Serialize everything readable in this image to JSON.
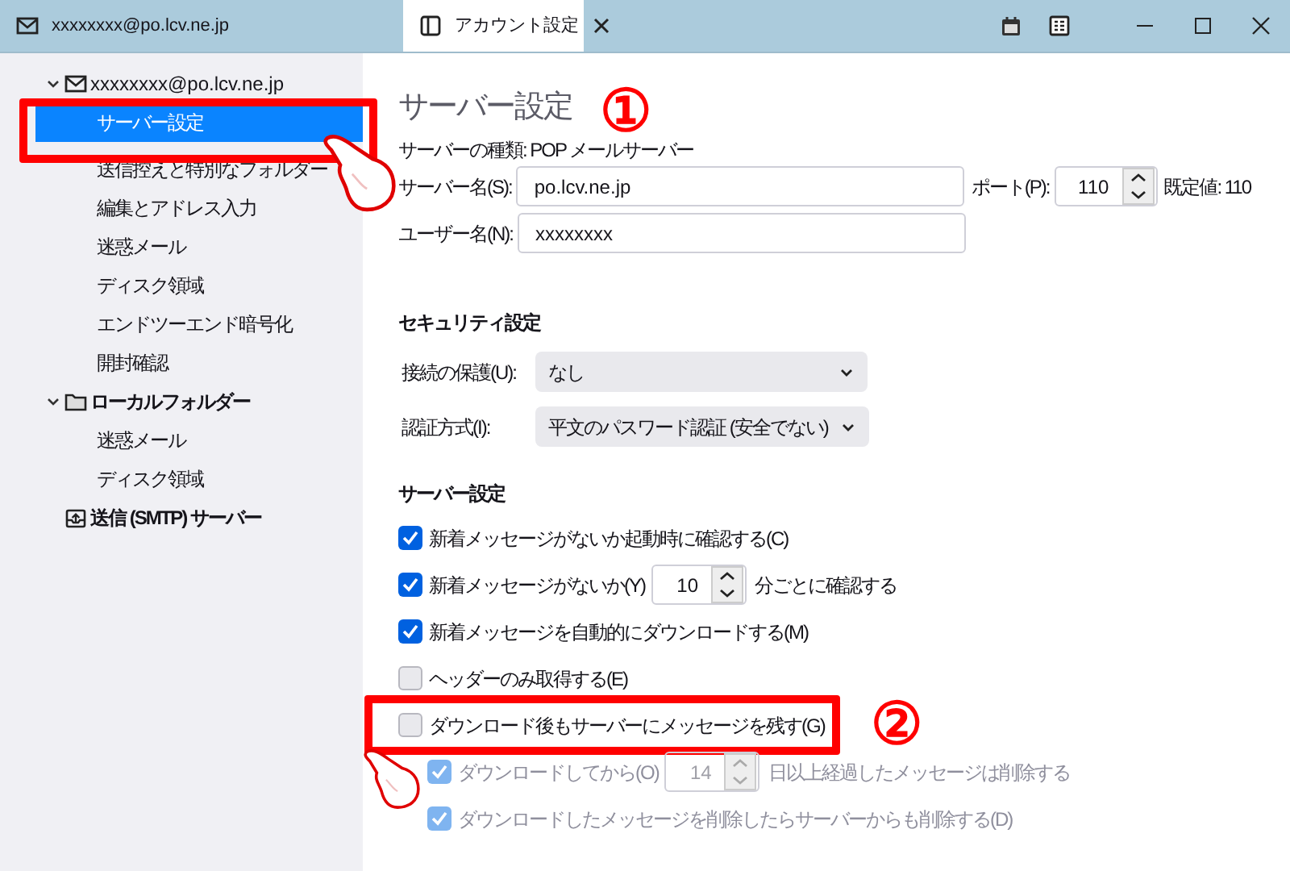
{
  "tabs": [
    {
      "label": "xxxxxxxx@po.lcv.ne.jp",
      "selected": false
    },
    {
      "label": "アカウント設定",
      "selected": true
    }
  ],
  "sidebar": {
    "items": [
      {
        "kind": "account",
        "label": "xxxxxxxx@po.lcv.ne.jp",
        "expanded": true,
        "selected": false,
        "children": [
          {
            "label": "サーバー設定",
            "selected": true
          },
          {
            "label": "送信控えと特別なフォルダー",
            "selected": false
          },
          {
            "label": "編集とアドレス入力",
            "selected": false
          },
          {
            "label": "迷惑メール",
            "selected": false
          },
          {
            "label": "ディスク領域",
            "selected": false
          },
          {
            "label": "エンドツーエンド暗号化",
            "selected": false
          },
          {
            "label": "開封確認",
            "selected": false
          }
        ]
      },
      {
        "kind": "folder",
        "label": "ローカルフォルダー",
        "expanded": true,
        "selected": false,
        "children": [
          {
            "label": "迷惑メール",
            "selected": false
          },
          {
            "label": "ディスク領域",
            "selected": false
          }
        ]
      },
      {
        "kind": "outbox",
        "label": "送信 (SMTP) サーバー",
        "selected": false
      }
    ]
  },
  "main": {
    "title": "サーバー設定",
    "server_type": "サーバーの種類: POP メールサーバー",
    "server_name": {
      "label": "サーバー名(S):",
      "value": "po.lcv.ne.jp"
    },
    "port": {
      "label": "ポート(P):",
      "value": "110",
      "default": "既定値: 110"
    },
    "user_name": {
      "label": "ユーザー名(N):",
      "value": "xxxxxxxx"
    },
    "security": {
      "heading": "セキュリティ設定",
      "fields": [
        {
          "label": "接続の保護(U):",
          "value": "なし"
        },
        {
          "label": "認証方式(I):",
          "value": "平文のパスワード認証 (安全でない)"
        }
      ]
    },
    "server_settings": {
      "heading": "サーバー設定",
      "options": [
        {
          "kind": "plain",
          "label": "新着メッセージがないか起動時に確認する(C)",
          "checked": true,
          "disabled": false
        },
        {
          "kind": "interval",
          "label": "新着メッセージがないか(Y)",
          "value": "10",
          "suffix": "分ごとに確認する",
          "checked": true,
          "disabled": false
        },
        {
          "kind": "plain",
          "label": "新着メッセージを自動的にダウンロードする(M)",
          "checked": true,
          "disabled": false
        },
        {
          "kind": "plain",
          "label": "ヘッダーのみ取得する(E)",
          "checked": false,
          "disabled": false
        },
        {
          "kind": "plain",
          "label": "ダウンロード後もサーバーにメッセージを残す(G)",
          "checked": false,
          "disabled": false,
          "children": [
            {
              "kind": "interval",
              "label": "ダウンロードしてから(O)",
              "value": "14",
              "suffix": "日以上経過したメッセージは削除する",
              "checked": true,
              "disabled": true
            },
            {
              "kind": "plain",
              "label": "ダウンロードしたメッセージを削除したらサーバーからも削除する(D)",
              "checked": true,
              "disabled": true
            }
          ]
        }
      ]
    }
  },
  "callouts": [
    "①",
    "②"
  ]
}
